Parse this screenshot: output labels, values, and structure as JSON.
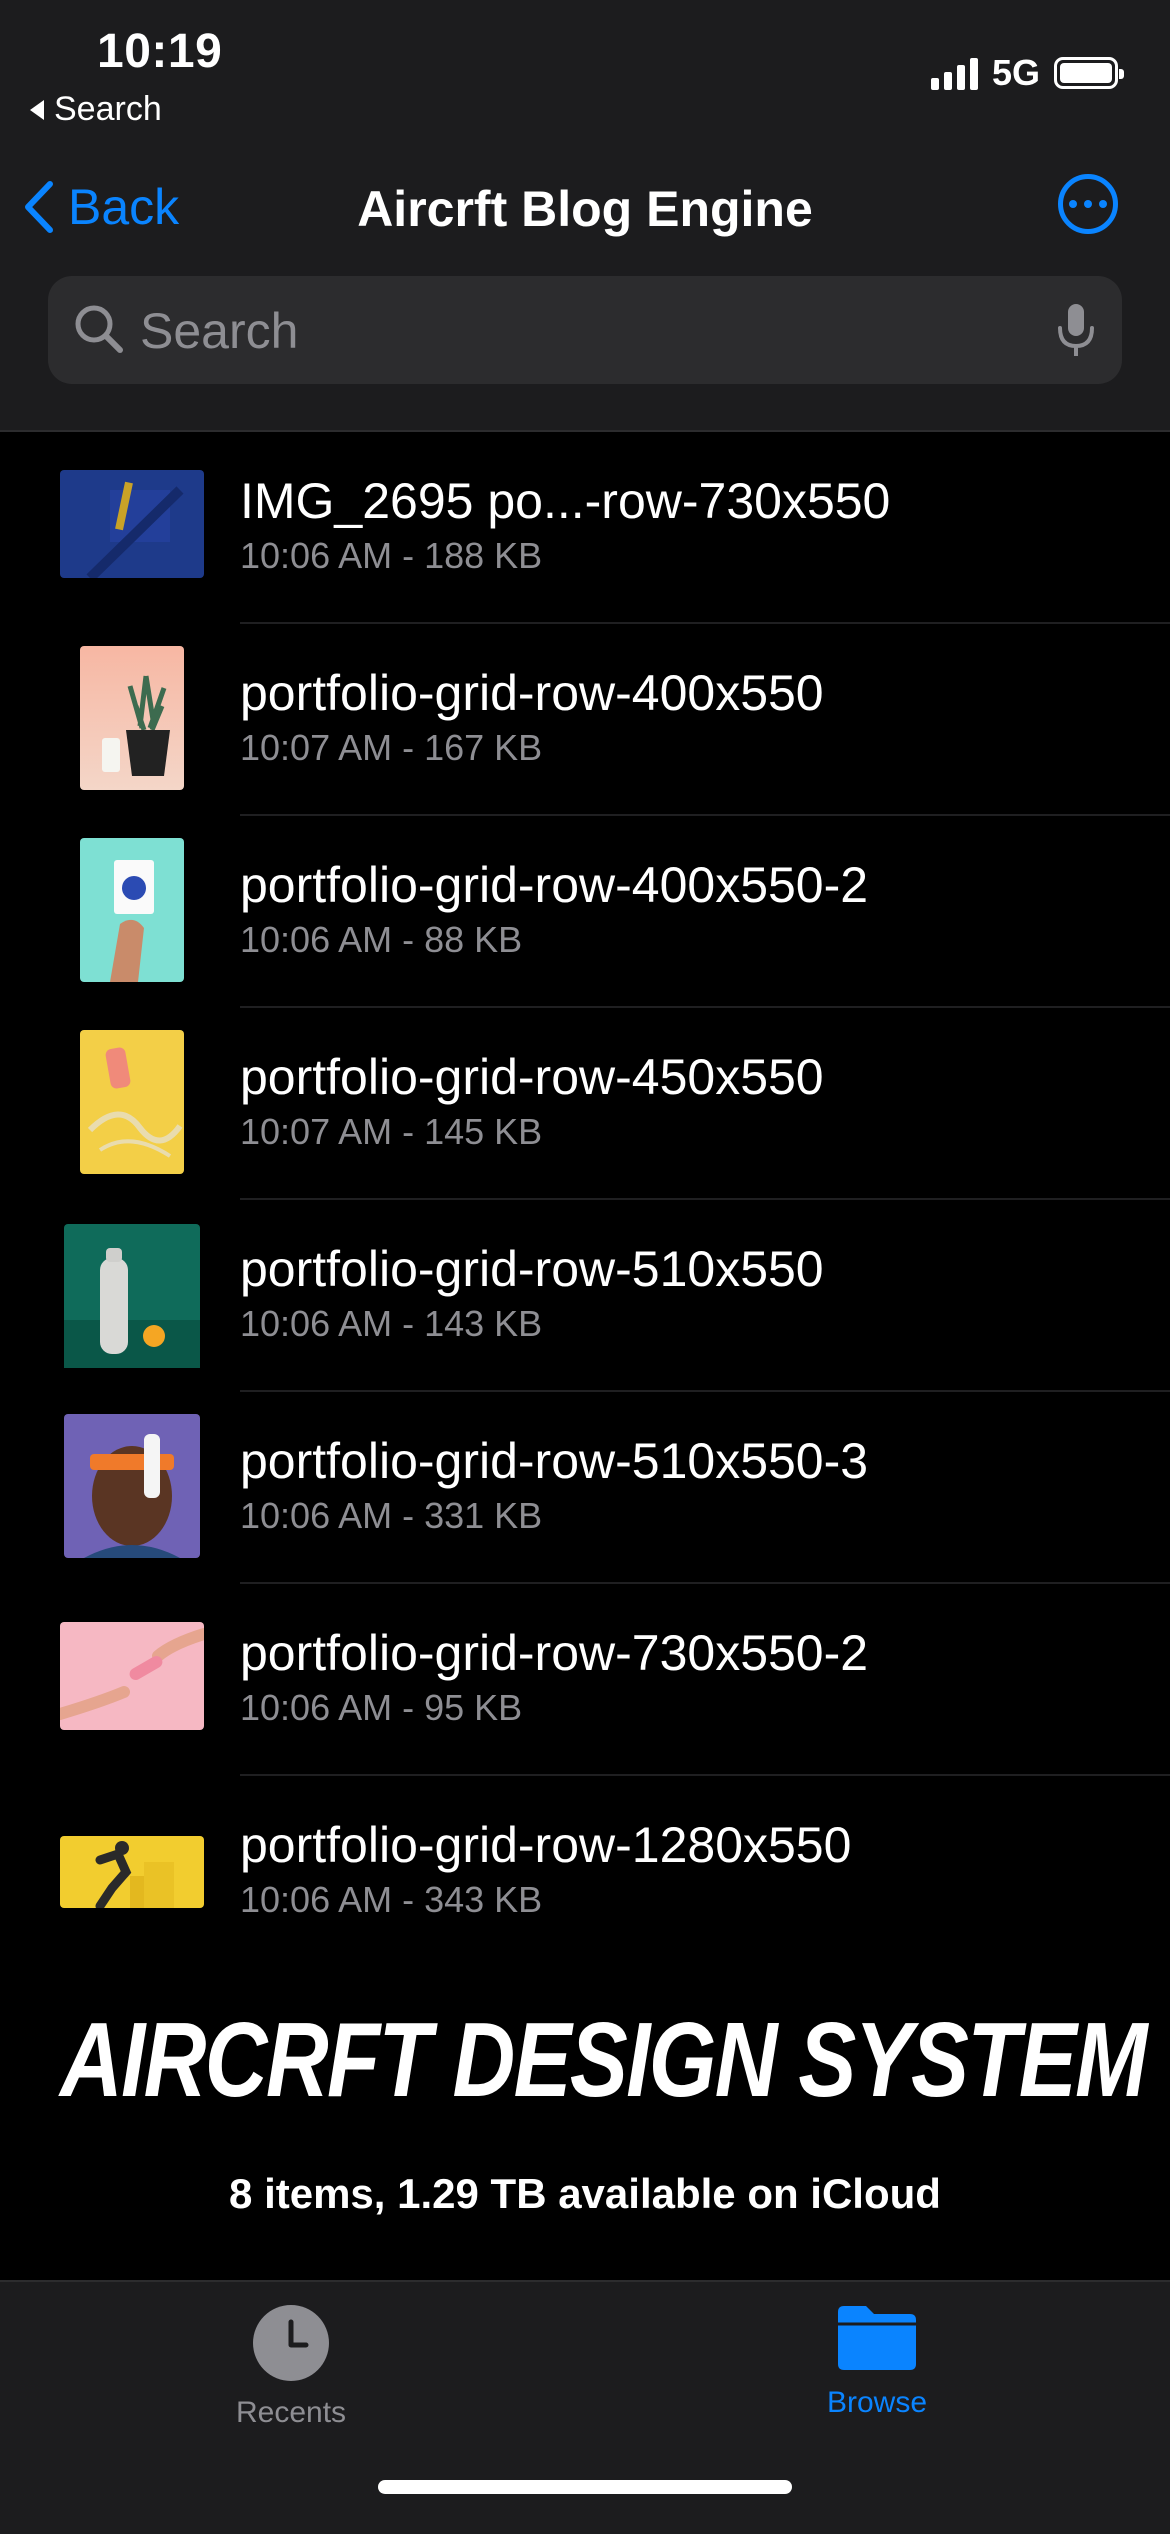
{
  "status_bar": {
    "time": "10:19",
    "back_app": "Search",
    "network": "5G",
    "icons": [
      "cellular-signal-icon",
      "battery-icon"
    ]
  },
  "nav": {
    "back_label": "Back",
    "title": "Aircrft Blog Engine",
    "more_icon": "ellipsis-circle-icon"
  },
  "search": {
    "placeholder": "Search",
    "value": ""
  },
  "files": [
    {
      "name": "IMG_2695 po...-row-730x550",
      "meta": "10:06 AM - 188 KB"
    },
    {
      "name": "portfolio-grid-row-400x550",
      "meta": "10:07 AM - 167 KB"
    },
    {
      "name": "portfolio-grid-row-400x550-2",
      "meta": "10:06 AM - 88 KB"
    },
    {
      "name": "portfolio-grid-row-450x550",
      "meta": "10:07 AM - 145 KB"
    },
    {
      "name": "portfolio-grid-row-510x550",
      "meta": "10:06 AM - 143 KB"
    },
    {
      "name": "portfolio-grid-row-510x550-3",
      "meta": "10:06 AM - 331 KB"
    },
    {
      "name": "portfolio-grid-row-730x550-2",
      "meta": "10:06 AM - 95 KB"
    },
    {
      "name": "portfolio-grid-row-1280x550",
      "meta": "10:06 AM - 343 KB"
    }
  ],
  "footer": {
    "brand": "AIRCRFT DESIGN SYSTEM",
    "summary": "8 items, 1.29 TB available on iCloud"
  },
  "tabs": [
    {
      "label": "Recents",
      "icon": "clock-icon",
      "active": false
    },
    {
      "label": "Browse",
      "icon": "folder-icon",
      "active": true
    }
  ],
  "colors": {
    "accent": "#0a84ff",
    "background": "#000000",
    "bar_background": "#1c1c1e",
    "secondary_text": "#8e8e93"
  }
}
